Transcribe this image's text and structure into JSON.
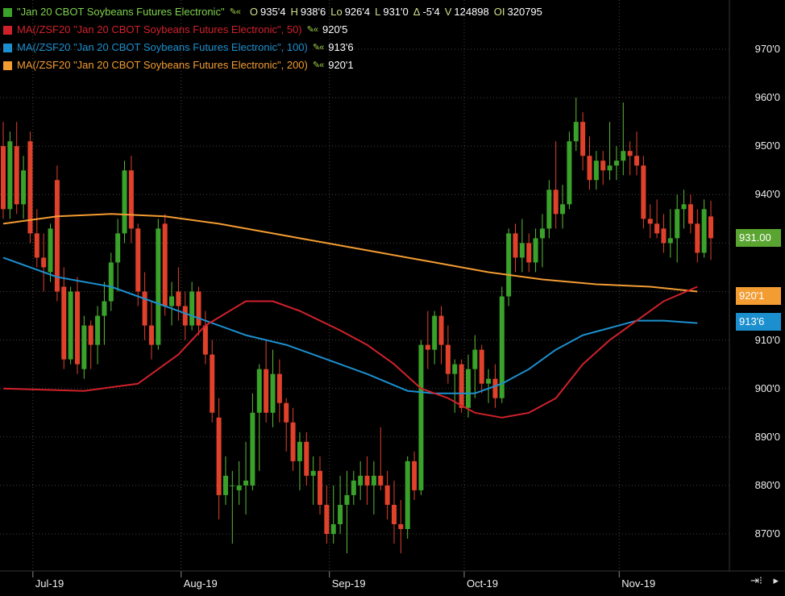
{
  "legend": {
    "series_label": "\"Jan 20 CBOT Soybeans Futures Electronic\"",
    "ohlc": [
      {
        "k": "O",
        "v": "935'4"
      },
      {
        "k": "H",
        "v": "938'6"
      },
      {
        "k": "Lo",
        "v": "926'4"
      },
      {
        "k": "L",
        "v": "931'0"
      },
      {
        "k": "Δ",
        "v": "-5'4"
      },
      {
        "k": "V",
        "v": "124898"
      },
      {
        "k": "OI",
        "v": "320795"
      }
    ],
    "ma": [
      {
        "label": "MA(/ZSF20 \"Jan 20 CBOT Soybeans Futures Electronic\", 50)",
        "value": "920'5",
        "color": "#d0212b"
      },
      {
        "label": "MA(/ZSF20 \"Jan 20 CBOT Soybeans Futures Electronic\", 100)",
        "value": "913'6",
        "color": "#1c8fce"
      },
      {
        "label": "MA(/ZSF20 \"Jan 20 CBOT Soybeans Futures Electronic\", 200)",
        "value": "920'1",
        "color": "#f39c32"
      }
    ],
    "tool_icons": "pencil-icon"
  },
  "price_tags": {
    "last": "931.00",
    "ma200": "920'1",
    "ma100": "913'6"
  },
  "colors": {
    "up": "#3aa12a",
    "down": "#e0412b",
    "ma50": "#d0212b",
    "ma100": "#1c8fce",
    "ma200": "#f39c32",
    "grid": "#444444",
    "tag_last": "#5aa531"
  },
  "chart_data": {
    "type": "candlestick",
    "y_ticks": [
      "970'0",
      "960'0",
      "950'0",
      "940'0",
      "930'0",
      "920'0",
      "910'0",
      "900'0",
      "890'0",
      "880'0",
      "870'0"
    ],
    "y_tick_values": [
      970,
      960,
      950,
      940,
      930,
      920,
      910,
      900,
      890,
      880,
      870
    ],
    "ylim": [
      864,
      976
    ],
    "x_ticks": [
      "Jul-19",
      "Aug-19",
      "Sep-19",
      "Oct-19",
      "Nov-19"
    ],
    "grid": true,
    "candles": [
      {
        "d": "2019-06-24",
        "o": 950,
        "h": 955,
        "l": 935,
        "c": 937
      },
      {
        "d": "2019-06-25",
        "o": 937,
        "h": 953,
        "l": 935,
        "c": 951
      },
      {
        "d": "2019-06-26",
        "o": 950,
        "h": 955,
        "l": 936,
        "c": 938
      },
      {
        "d": "2019-06-27",
        "o": 938,
        "h": 948,
        "l": 935,
        "c": 945
      },
      {
        "d": "2019-06-28",
        "o": 951,
        "h": 953,
        "l": 930,
        "c": 932
      },
      {
        "d": "2019-07-01",
        "o": 932,
        "h": 937,
        "l": 925,
        "c": 927
      },
      {
        "d": "2019-07-02",
        "o": 927,
        "h": 932,
        "l": 920,
        "c": 925
      },
      {
        "d": "2019-07-03",
        "o": 924,
        "h": 934,
        "l": 922,
        "c": 933
      },
      {
        "d": "2019-07-05",
        "o": 943,
        "h": 946,
        "l": 918,
        "c": 920
      },
      {
        "d": "2019-07-08",
        "o": 921,
        "h": 925,
        "l": 904,
        "c": 906
      },
      {
        "d": "2019-07-09",
        "o": 906,
        "h": 921,
        "l": 905,
        "c": 920
      },
      {
        "d": "2019-07-10",
        "o": 920,
        "h": 923,
        "l": 903,
        "c": 905
      },
      {
        "d": "2019-07-11",
        "o": 904,
        "h": 915,
        "l": 902,
        "c": 913
      },
      {
        "d": "2019-07-12",
        "o": 913,
        "h": 914,
        "l": 904,
        "c": 909
      },
      {
        "d": "2019-07-15",
        "o": 909,
        "h": 917,
        "l": 905,
        "c": 915
      },
      {
        "d": "2019-07-16",
        "o": 915,
        "h": 922,
        "l": 909,
        "c": 918
      },
      {
        "d": "2019-07-17",
        "o": 918,
        "h": 928,
        "l": 916,
        "c": 926
      },
      {
        "d": "2019-07-18",
        "o": 926,
        "h": 935,
        "l": 920,
        "c": 932
      },
      {
        "d": "2019-07-19",
        "o": 932,
        "h": 947,
        "l": 930,
        "c": 945
      },
      {
        "d": "2019-07-22",
        "o": 945,
        "h": 948,
        "l": 930,
        "c": 933
      },
      {
        "d": "2019-07-23",
        "o": 933,
        "h": 934,
        "l": 917,
        "c": 920
      },
      {
        "d": "2019-07-24",
        "o": 920,
        "h": 924,
        "l": 910,
        "c": 913
      },
      {
        "d": "2019-07-25",
        "o": 913,
        "h": 918,
        "l": 906,
        "c": 909
      },
      {
        "d": "2019-07-26",
        "o": 909,
        "h": 935,
        "l": 908,
        "c": 933
      },
      {
        "d": "2019-07-29",
        "o": 934,
        "h": 936,
        "l": 915,
        "c": 917
      },
      {
        "d": "2019-07-30",
        "o": 917,
        "h": 922,
        "l": 913,
        "c": 919
      },
      {
        "d": "2019-07-31",
        "o": 920,
        "h": 925,
        "l": 914,
        "c": 917
      },
      {
        "d": "2019-08-01",
        "o": 917,
        "h": 920,
        "l": 910,
        "c": 913
      },
      {
        "d": "2019-08-02",
        "o": 913,
        "h": 922,
        "l": 912,
        "c": 920
      },
      {
        "d": "2019-08-05",
        "o": 920,
        "h": 921,
        "l": 911,
        "c": 913
      },
      {
        "d": "2019-08-06",
        "o": 913,
        "h": 916,
        "l": 905,
        "c": 907
      },
      {
        "d": "2019-08-07",
        "o": 907,
        "h": 910,
        "l": 893,
        "c": 895
      },
      {
        "d": "2019-08-08",
        "o": 894,
        "h": 898,
        "l": 873,
        "c": 878
      },
      {
        "d": "2019-08-09",
        "o": 878,
        "h": 886,
        "l": 876,
        "c": 882
      },
      {
        "d": "2019-08-12",
        "o": 880,
        "h": 883,
        "l": 868,
        "c": 880
      },
      {
        "d": "2019-08-13",
        "o": 879,
        "h": 885,
        "l": 876,
        "c": 880
      },
      {
        "d": "2019-08-14",
        "o": 880,
        "h": 889,
        "l": 874,
        "c": 881
      },
      {
        "d": "2019-08-15",
        "o": 880,
        "h": 899,
        "l": 879,
        "c": 895
      },
      {
        "d": "2019-08-16",
        "o": 895,
        "h": 905,
        "l": 883,
        "c": 904
      },
      {
        "d": "2019-08-19",
        "o": 904,
        "h": 910,
        "l": 893,
        "c": 895
      },
      {
        "d": "2019-08-20",
        "o": 895,
        "h": 908,
        "l": 892,
        "c": 903
      },
      {
        "d": "2019-08-21",
        "o": 903,
        "h": 906,
        "l": 893,
        "c": 897
      },
      {
        "d": "2019-08-22",
        "o": 897,
        "h": 898,
        "l": 887,
        "c": 893
      },
      {
        "d": "2019-08-23",
        "o": 893,
        "h": 896,
        "l": 883,
        "c": 885
      },
      {
        "d": "2019-08-26",
        "o": 885,
        "h": 891,
        "l": 879,
        "c": 889
      },
      {
        "d": "2019-08-27",
        "o": 889,
        "h": 891,
        "l": 880,
        "c": 882
      },
      {
        "d": "2019-08-28",
        "o": 882,
        "h": 886,
        "l": 876,
        "c": 883
      },
      {
        "d": "2019-08-29",
        "o": 883,
        "h": 886,
        "l": 874,
        "c": 876
      },
      {
        "d": "2019-08-30",
        "o": 876,
        "h": 880,
        "l": 868,
        "c": 870
      },
      {
        "d": "2019-09-03",
        "o": 870,
        "h": 880,
        "l": 868,
        "c": 872
      },
      {
        "d": "2019-09-04",
        "o": 872,
        "h": 882,
        "l": 870,
        "c": 876
      },
      {
        "d": "2019-09-05",
        "o": 876,
        "h": 883,
        "l": 866,
        "c": 878
      },
      {
        "d": "2019-09-06",
        "o": 878,
        "h": 883,
        "l": 876,
        "c": 881
      },
      {
        "d": "2019-09-09",
        "o": 880,
        "h": 885,
        "l": 877,
        "c": 882
      },
      {
        "d": "2019-09-10",
        "o": 882,
        "h": 886,
        "l": 876,
        "c": 880
      },
      {
        "d": "2019-09-11",
        "o": 880,
        "h": 885,
        "l": 874,
        "c": 882
      },
      {
        "d": "2019-09-12",
        "o": 882,
        "h": 892,
        "l": 879,
        "c": 880
      },
      {
        "d": "2019-09-13",
        "o": 880,
        "h": 883,
        "l": 873,
        "c": 876
      },
      {
        "d": "2019-09-16",
        "o": 876,
        "h": 881,
        "l": 868,
        "c": 872
      },
      {
        "d": "2019-09-17",
        "o": 872,
        "h": 877,
        "l": 866,
        "c": 871
      },
      {
        "d": "2019-09-18",
        "o": 871,
        "h": 886,
        "l": 869,
        "c": 885
      },
      {
        "d": "2019-09-19",
        "o": 885,
        "h": 887,
        "l": 877,
        "c": 879
      },
      {
        "d": "2019-09-20",
        "o": 879,
        "h": 910,
        "l": 878,
        "c": 909
      },
      {
        "d": "2019-09-23",
        "o": 909,
        "h": 916,
        "l": 904,
        "c": 908
      },
      {
        "d": "2019-09-24",
        "o": 908,
        "h": 916,
        "l": 905,
        "c": 915
      },
      {
        "d": "2019-09-25",
        "o": 915,
        "h": 917,
        "l": 905,
        "c": 909
      },
      {
        "d": "2019-09-26",
        "o": 909,
        "h": 913,
        "l": 901,
        "c": 903
      },
      {
        "d": "2019-09-27",
        "o": 903,
        "h": 906,
        "l": 895,
        "c": 905
      },
      {
        "d": "2019-09-30",
        "o": 905,
        "h": 906,
        "l": 895,
        "c": 896
      },
      {
        "d": "2019-10-01",
        "o": 896,
        "h": 907,
        "l": 894,
        "c": 904
      },
      {
        "d": "2019-10-02",
        "o": 904,
        "h": 911,
        "l": 898,
        "c": 908
      },
      {
        "d": "2019-10-03",
        "o": 908,
        "h": 909,
        "l": 899,
        "c": 901
      },
      {
        "d": "2019-10-04",
        "o": 901,
        "h": 904,
        "l": 897,
        "c": 902
      },
      {
        "d": "2019-10-07",
        "o": 902,
        "h": 905,
        "l": 896,
        "c": 898
      },
      {
        "d": "2019-10-08",
        "o": 898,
        "h": 921,
        "l": 897,
        "c": 919
      },
      {
        "d": "2019-10-09",
        "o": 919,
        "h": 933,
        "l": 917,
        "c": 932
      },
      {
        "d": "2019-10-10",
        "o": 932,
        "h": 934,
        "l": 924,
        "c": 927
      },
      {
        "d": "2019-10-11",
        "o": 927,
        "h": 935,
        "l": 924,
        "c": 930
      },
      {
        "d": "2019-10-14",
        "o": 930,
        "h": 932,
        "l": 924,
        "c": 926
      },
      {
        "d": "2019-10-15",
        "o": 926,
        "h": 933,
        "l": 924,
        "c": 931
      },
      {
        "d": "2019-10-16",
        "o": 931,
        "h": 936,
        "l": 925,
        "c": 933
      },
      {
        "d": "2019-10-17",
        "o": 933,
        "h": 943,
        "l": 931,
        "c": 941
      },
      {
        "d": "2019-10-18",
        "o": 941,
        "h": 951,
        "l": 933,
        "c": 936
      },
      {
        "d": "2019-10-21",
        "o": 936,
        "h": 942,
        "l": 933,
        "c": 938
      },
      {
        "d": "2019-10-22",
        "o": 938,
        "h": 953,
        "l": 937,
        "c": 951
      },
      {
        "d": "2019-10-23",
        "o": 951,
        "h": 960,
        "l": 949,
        "c": 955
      },
      {
        "d": "2019-10-24",
        "o": 955,
        "h": 957,
        "l": 945,
        "c": 948
      },
      {
        "d": "2019-10-25",
        "o": 948,
        "h": 952,
        "l": 941,
        "c": 943
      },
      {
        "d": "2019-10-28",
        "o": 943,
        "h": 949,
        "l": 941,
        "c": 947
      },
      {
        "d": "2019-10-29",
        "o": 947,
        "h": 949,
        "l": 942,
        "c": 945
      },
      {
        "d": "2019-10-30",
        "o": 945,
        "h": 955,
        "l": 943,
        "c": 946
      },
      {
        "d": "2019-10-31",
        "o": 946,
        "h": 950,
        "l": 943,
        "c": 947
      },
      {
        "d": "2019-11-01",
        "o": 947,
        "h": 959,
        "l": 944,
        "c": 949
      },
      {
        "d": "2019-11-04",
        "o": 949,
        "h": 951,
        "l": 944,
        "c": 948
      },
      {
        "d": "2019-11-05",
        "o": 948,
        "h": 953,
        "l": 944,
        "c": 946
      },
      {
        "d": "2019-11-06",
        "o": 946,
        "h": 948,
        "l": 933,
        "c": 935
      },
      {
        "d": "2019-11-07",
        "o": 935,
        "h": 938,
        "l": 931,
        "c": 934
      },
      {
        "d": "2019-11-08",
        "o": 934,
        "h": 939,
        "l": 931,
        "c": 932
      },
      {
        "d": "2019-11-11",
        "o": 933,
        "h": 936,
        "l": 928,
        "c": 930
      },
      {
        "d": "2019-11-12",
        "o": 930,
        "h": 937,
        "l": 927,
        "c": 931
      },
      {
        "d": "2019-11-13",
        "o": 931,
        "h": 940,
        "l": 926,
        "c": 937
      },
      {
        "d": "2019-11-14",
        "o": 937,
        "h": 941,
        "l": 933,
        "c": 938
      },
      {
        "d": "2019-11-15",
        "o": 938,
        "h": 940,
        "l": 932,
        "c": 934
      },
      {
        "d": "2019-11-18",
        "o": 934,
        "h": 937,
        "l": 926,
        "c": 928
      },
      {
        "d": "2019-11-19",
        "o": 928,
        "h": 939,
        "l": 927,
        "c": 937
      },
      {
        "d": "2019-11-20",
        "o": 935.5,
        "h": 938.75,
        "l": 926.5,
        "c": 931
      }
    ],
    "ma50": [
      [
        0,
        900
      ],
      [
        12,
        899.5
      ],
      [
        20,
        901
      ],
      [
        26,
        907
      ],
      [
        30,
        913
      ],
      [
        36,
        918
      ],
      [
        40,
        918
      ],
      [
        44,
        916
      ],
      [
        50,
        912
      ],
      [
        54,
        909
      ],
      [
        58,
        905
      ],
      [
        62,
        900
      ],
      [
        66,
        898
      ],
      [
        70,
        895
      ],
      [
        74,
        894
      ],
      [
        78,
        895
      ],
      [
        82,
        898
      ],
      [
        86,
        905
      ],
      [
        90,
        910
      ],
      [
        94,
        914
      ],
      [
        98,
        918
      ],
      [
        103,
        921
      ]
    ],
    "ma100": [
      [
        0,
        927
      ],
      [
        8,
        923
      ],
      [
        16,
        921
      ],
      [
        24,
        917
      ],
      [
        30,
        914
      ],
      [
        36,
        911
      ],
      [
        42,
        909
      ],
      [
        48,
        906
      ],
      [
        54,
        903
      ],
      [
        60,
        899.5
      ],
      [
        64,
        899
      ],
      [
        70,
        899
      ],
      [
        74,
        901
      ],
      [
        78,
        904
      ],
      [
        82,
        908
      ],
      [
        86,
        911
      ],
      [
        90,
        912.5
      ],
      [
        94,
        914
      ],
      [
        98,
        914
      ],
      [
        103,
        913.5
      ]
    ],
    "ma200": [
      [
        0,
        934
      ],
      [
        8,
        935.5
      ],
      [
        16,
        936
      ],
      [
        24,
        935.5
      ],
      [
        32,
        934
      ],
      [
        40,
        932
      ],
      [
        48,
        930
      ],
      [
        56,
        928
      ],
      [
        64,
        926
      ],
      [
        72,
        924
      ],
      [
        80,
        922.5
      ],
      [
        88,
        921.5
      ],
      [
        96,
        921
      ],
      [
        103,
        920
      ]
    ]
  }
}
